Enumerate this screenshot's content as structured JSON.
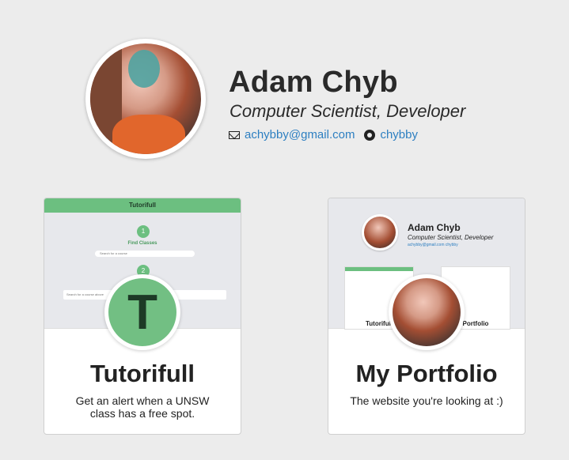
{
  "profile": {
    "name": "Adam Chyb",
    "subtitle": "Computer Scientist, Developer",
    "email": "achybby@gmail.com",
    "github": "chybby"
  },
  "cards": [
    {
      "title": "Tutorifull",
      "description": "Get an alert when a UNSW class has a free spot.",
      "badge_letter": "T",
      "preview": {
        "bar_title": "Tutorifull",
        "step1": "1",
        "step1_label": "Find Classes",
        "search_placeholder": "Search for a course",
        "step2": "2",
        "search_placeholder2": "Search for a course above"
      }
    },
    {
      "title": "My Portfolio",
      "description": "The website you're looking at :)",
      "preview": {
        "name": "Adam Chyb",
        "subtitle": "Computer Scientist, Developer",
        "contacts": "achybby@gmail.com  chybby",
        "mini1": "Tutorifull",
        "mini2": "Portfolio"
      }
    }
  ],
  "colors": {
    "background": "#ececec",
    "accent_green": "#72bf83",
    "link": "#2d7fc1"
  }
}
